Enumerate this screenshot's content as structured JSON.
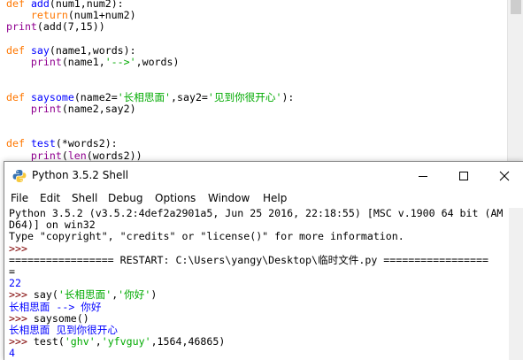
{
  "editor": {
    "lines": [
      [
        {
          "t": "def",
          "c": "kw"
        },
        {
          "t": " ",
          "c": ""
        },
        {
          "t": "add",
          "c": "def"
        },
        {
          "t": "(num1,num2):",
          "c": ""
        }
      ],
      [
        {
          "t": "    ",
          "c": ""
        },
        {
          "t": "return",
          "c": "kw"
        },
        {
          "t": "(num1+num2)",
          "c": ""
        }
      ],
      [
        {
          "t": "print",
          "c": "bi"
        },
        {
          "t": "(add(7,15))",
          "c": ""
        }
      ],
      [],
      [
        {
          "t": "def",
          "c": "kw"
        },
        {
          "t": " ",
          "c": ""
        },
        {
          "t": "say",
          "c": "def"
        },
        {
          "t": "(name1,words):",
          "c": ""
        }
      ],
      [
        {
          "t": "    ",
          "c": ""
        },
        {
          "t": "print",
          "c": "bi"
        },
        {
          "t": "(name1,",
          "c": ""
        },
        {
          "t": "'-->'",
          "c": "str"
        },
        {
          "t": ",words)",
          "c": ""
        }
      ],
      [],
      [],
      [
        {
          "t": "def",
          "c": "kw"
        },
        {
          "t": " ",
          "c": ""
        },
        {
          "t": "saysome",
          "c": "def"
        },
        {
          "t": "(name2=",
          "c": ""
        },
        {
          "t": "'长相思面'",
          "c": "str"
        },
        {
          "t": ",say2=",
          "c": ""
        },
        {
          "t": "'见到你很开心'",
          "c": "str"
        },
        {
          "t": "):",
          "c": ""
        }
      ],
      [
        {
          "t": "    ",
          "c": ""
        },
        {
          "t": "print",
          "c": "bi"
        },
        {
          "t": "(name2,say2)",
          "c": ""
        }
      ],
      [],
      [],
      [
        {
          "t": "def",
          "c": "kw"
        },
        {
          "t": " ",
          "c": ""
        },
        {
          "t": "test",
          "c": "def"
        },
        {
          "t": "(*words2):",
          "c": ""
        }
      ],
      [
        {
          "t": "    ",
          "c": ""
        },
        {
          "t": "print",
          "c": "bi"
        },
        {
          "t": "(",
          "c": ""
        },
        {
          "t": "len",
          "c": "bi"
        },
        {
          "t": "(words2))",
          "c": ""
        }
      ]
    ]
  },
  "shell": {
    "title": "Python 3.5.2 Shell",
    "icons": {
      "app": "python-logo-icon",
      "minimize": "minimize-icon",
      "maximize": "maximize-icon",
      "close": "close-icon"
    },
    "menu": [
      "File",
      "Edit",
      "Shell",
      "Debug",
      "Options",
      "Window",
      "Help"
    ],
    "console_lines": [
      [
        {
          "t": "Python 3.5.2 (v3.5.2:4def2a2901a5, Jun 25 2016, 22:18:55) [MSC v.1900 64 bit (AM",
          "c": "out"
        }
      ],
      [
        {
          "t": "D64)] on win32",
          "c": "out"
        }
      ],
      [
        {
          "t": "Type \"copyright\", \"credits\" or \"license()\" for more information.",
          "c": "out"
        }
      ],
      [
        {
          "t": ">>> ",
          "c": "prompt"
        }
      ],
      [
        {
          "t": "================= RESTART: C:\\Users\\yangy\\Desktop\\临时文件.py =================",
          "c": "restart"
        }
      ],
      [
        {
          "t": "=",
          "c": "restart"
        }
      ],
      [
        {
          "t": "22",
          "c": "res"
        }
      ],
      [
        {
          "t": ">>> ",
          "c": "prompt"
        },
        {
          "t": "say(",
          "c": "out"
        },
        {
          "t": "'长相思面'",
          "c": "str"
        },
        {
          "t": ",",
          "c": "out"
        },
        {
          "t": "'你好'",
          "c": "str"
        },
        {
          "t": ")",
          "c": "out"
        }
      ],
      [
        {
          "t": "长相思面 --> 你好",
          "c": "res"
        }
      ],
      [
        {
          "t": ">>> ",
          "c": "prompt"
        },
        {
          "t": "saysome()",
          "c": "out"
        }
      ],
      [
        {
          "t": "长相思面 见到你很开心",
          "c": "res"
        }
      ],
      [
        {
          "t": ">>> ",
          "c": "prompt"
        },
        {
          "t": "test(",
          "c": "out"
        },
        {
          "t": "'ghv'",
          "c": "str"
        },
        {
          "t": ",",
          "c": "out"
        },
        {
          "t": "'yfvguy'",
          "c": "str"
        },
        {
          "t": ",1564,46865)",
          "c": "out"
        }
      ],
      [
        {
          "t": "4",
          "c": "res"
        }
      ],
      [
        {
          "t": ">>> ",
          "c": "prompt"
        }
      ]
    ]
  }
}
